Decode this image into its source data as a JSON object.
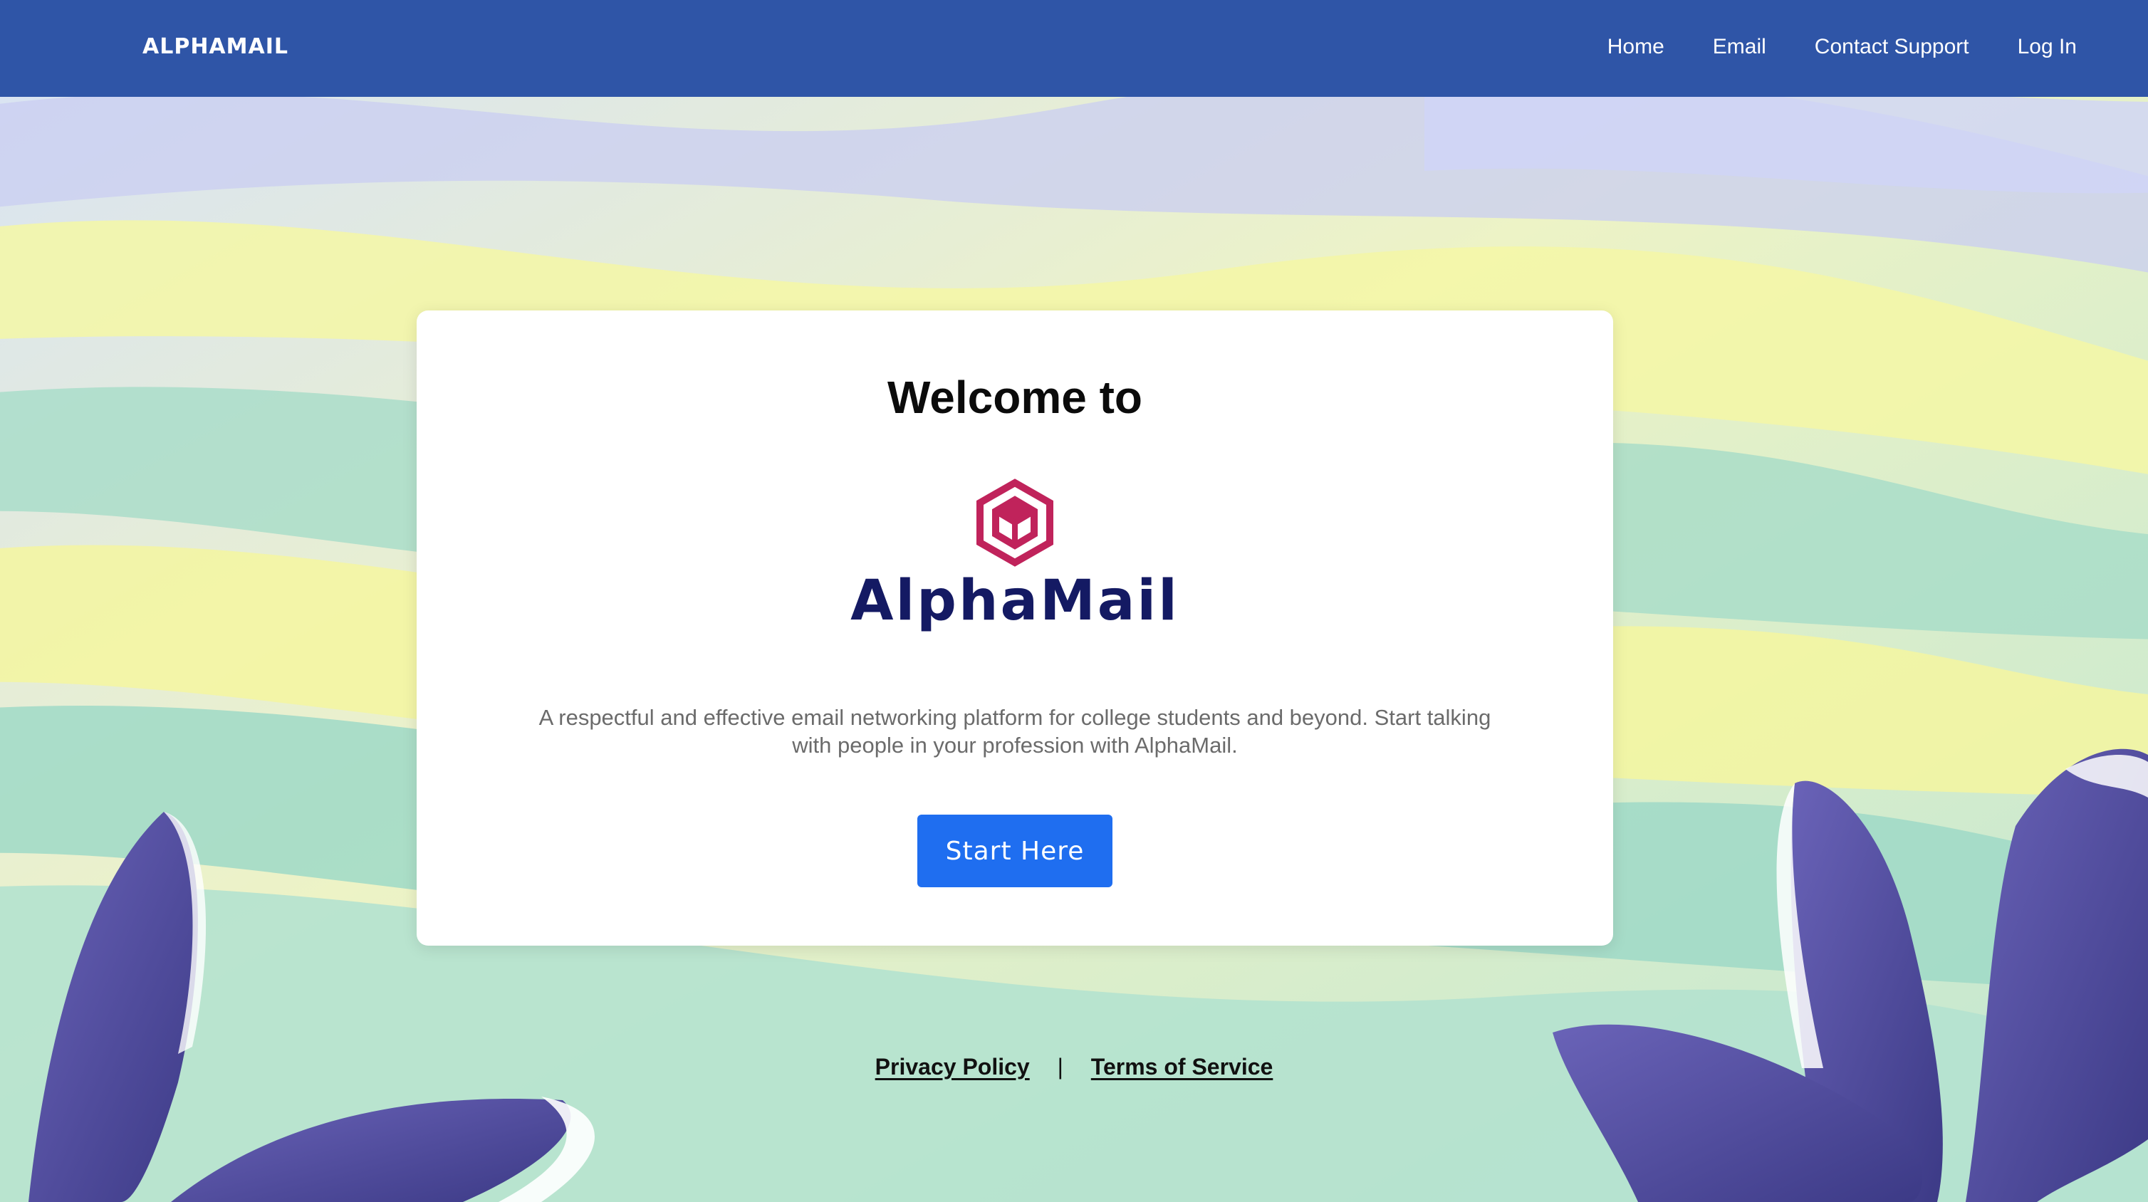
{
  "navbar": {
    "brand": "ALPHAMAIL",
    "links": [
      "Home",
      "Email",
      "Contact Support",
      "Log In"
    ],
    "background_color": "#2f55a7"
  },
  "card": {
    "heading": "Welcome to",
    "logo_icon": "hexagon-cube-icon",
    "logo_color": "#c0235b",
    "logo_text": "AlphaMail",
    "logo_text_color": "#141a63",
    "description": "A respectful and effective email networking platform for college students and beyond. Start talking with people in your profession with AlphaMail.",
    "cta_label": "Start Here",
    "cta_color": "#1f6ef0"
  },
  "footer": {
    "privacy_label": "Privacy Policy",
    "separator": "|",
    "terms_label": "Terms of Service"
  }
}
